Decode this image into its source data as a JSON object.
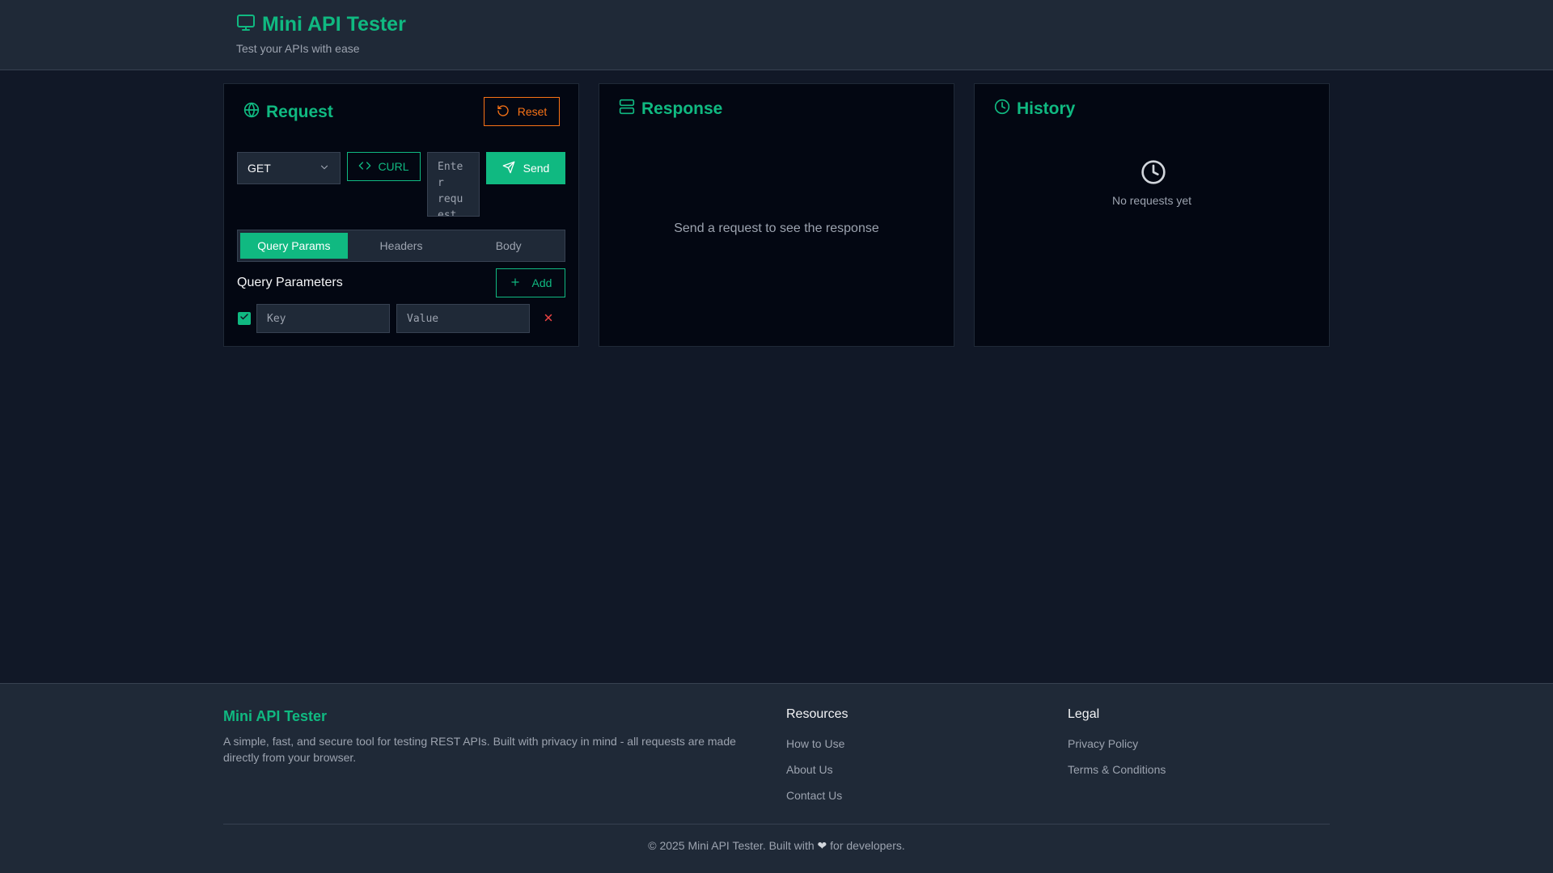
{
  "header": {
    "title": "Mini API Tester",
    "subtitle": "Test your APIs with ease",
    "logo_icon": "monitor-icon"
  },
  "request": {
    "title": "Request",
    "reset_label": "Reset",
    "method": "GET",
    "curl_label": "CURL",
    "url_placeholder": "Enter request URL",
    "send_label": "Send",
    "tabs": [
      {
        "label": "Query Params",
        "active": true
      },
      {
        "label": "Headers",
        "active": false
      },
      {
        "label": "Body",
        "active": false
      }
    ],
    "section_label": "Query Parameters",
    "add_label": "Add",
    "params": [
      {
        "enabled": true,
        "key_placeholder": "Key",
        "value_placeholder": "Value"
      }
    ]
  },
  "response": {
    "title": "Response",
    "empty_text": "Send a request to see the response"
  },
  "history": {
    "title": "History",
    "empty_text": "No requests yet"
  },
  "footer": {
    "brand": "Mini API Tester",
    "description": "A simple, fast, and secure tool for testing REST APIs. Built with privacy in mind - all requests are made directly from your browser.",
    "resources_title": "Resources",
    "resources": [
      "How to Use",
      "About Us",
      "Contact Us"
    ],
    "legal_title": "Legal",
    "legal": [
      "Privacy Policy",
      "Terms & Conditions"
    ],
    "copyright_prefix": "© 2025 Mini API Tester. Built with",
    "copyright_suffix": "for developers."
  },
  "colors": {
    "accent": "#10b981",
    "warning": "#f97316",
    "danger": "#ef4444",
    "background": "#111827",
    "panel": "#030712"
  }
}
